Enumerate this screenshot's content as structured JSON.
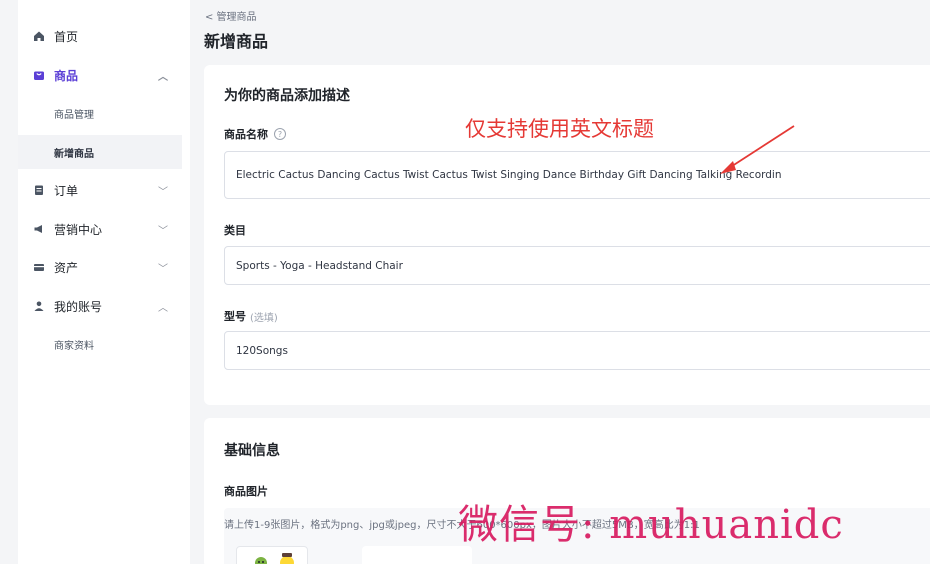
{
  "sidebar": {
    "home": "首页",
    "products": "商品",
    "product_manage": "商品管理",
    "product_add": "新增商品",
    "orders": "订单",
    "marketing": "营销中心",
    "assets": "资产",
    "my_account": "我的账号",
    "merchant_profile": "商家资料"
  },
  "header": {
    "breadcrumb": "< 管理商品",
    "title": "新增商品"
  },
  "description_card": {
    "title": "为你的商品添加描述",
    "name_label": "商品名称",
    "help": "?",
    "name_value": "Electric Cactus Dancing Cactus Twist Cactus Twist Singing Dance Birthday Gift Dancing Talking Recordin",
    "category_label": "类目",
    "category_value": "Sports - Yoga - Headstand Chair",
    "model_label": "型号",
    "model_optional": "(选填)",
    "model_value": "120Songs"
  },
  "annotation": {
    "text": "仅支持使用英文标题",
    "color": "#e53935"
  },
  "basic_card": {
    "title": "基础信息",
    "images_label": "商品图片",
    "upload_hint": "请上传1-9张图片，格式为png、jpg或jpeg，尺寸不大于600*600px，图片大小不超过5MB，宽高比为1:1"
  },
  "watermark": {
    "text": "微信号: muhuanidc",
    "color": "#d81b60"
  },
  "colors": {
    "accent": "#5b3fd6",
    "background": "#f4f5f7"
  }
}
